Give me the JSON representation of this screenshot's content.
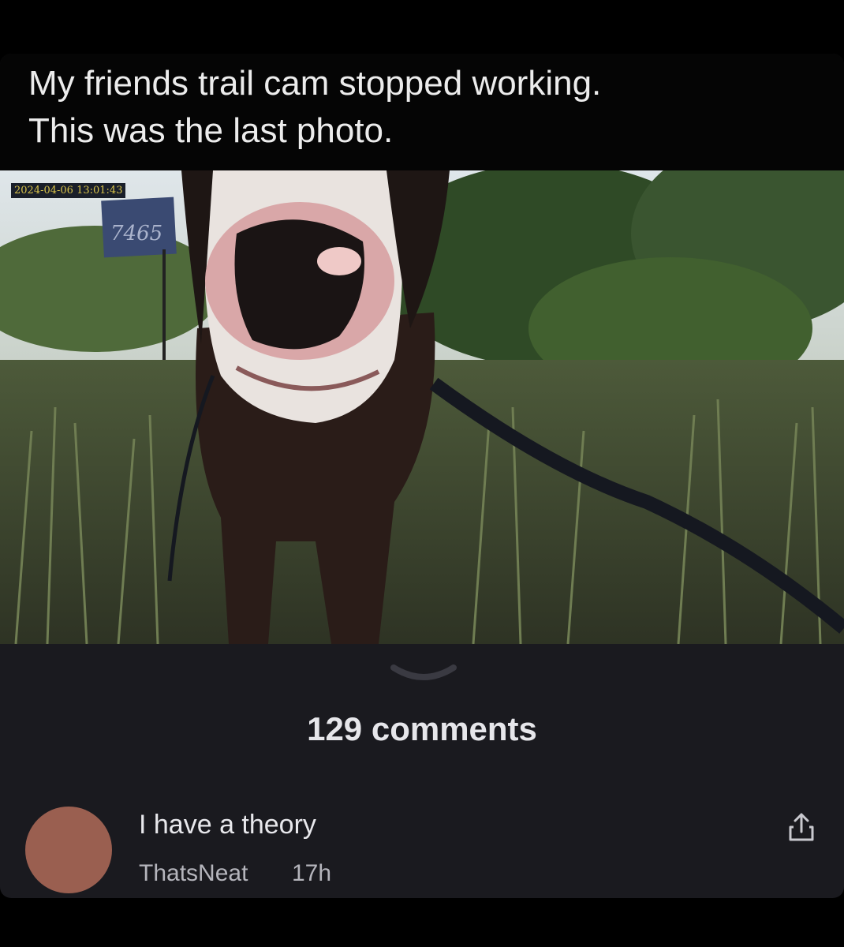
{
  "post": {
    "caption": "My friends trail cam stopped working.\nThis was the last photo.",
    "photo": {
      "subject": "cow-face",
      "timestamp": "2024-04-06 13:01:43",
      "tag_number": "7465"
    }
  },
  "comments_section": {
    "count_label": "129 comments",
    "collapse_icon": "chevron-down-icon"
  },
  "comment": {
    "text": "I have a theory",
    "author": "ThatsNeat",
    "time": "17h",
    "avatar_color": "#9a5f50",
    "share_icon": "share-icon"
  },
  "colors": {
    "background": "#000000",
    "card": "#1a1a1f",
    "caption_bg": "#050505",
    "text_primary": "#e8e8ec",
    "text_secondary": "#b5b5bc"
  }
}
